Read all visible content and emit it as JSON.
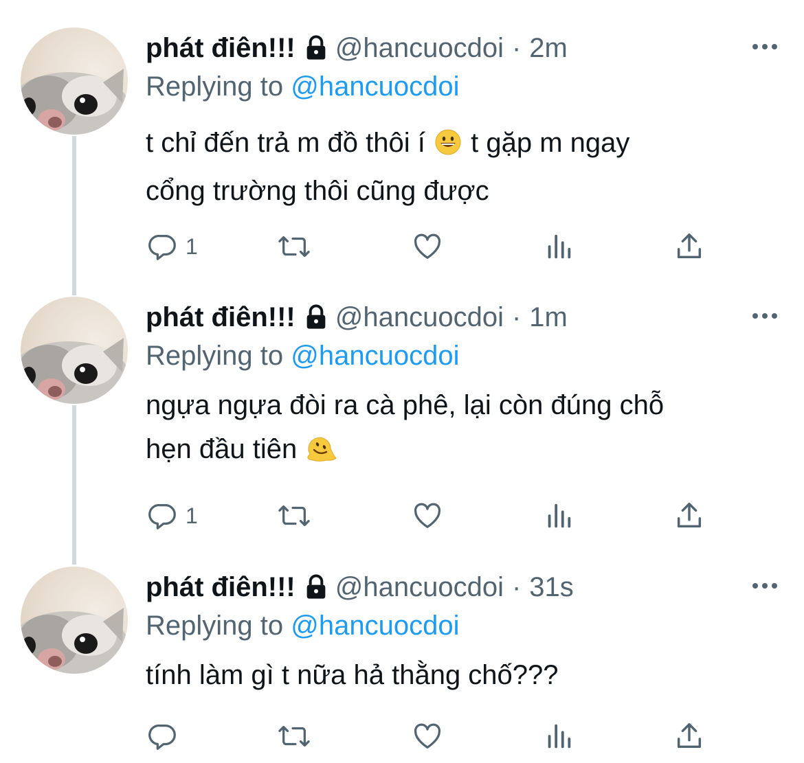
{
  "tweets": [
    {
      "name": "phát điên!!!",
      "handle": "@hancuocdoi",
      "time": "2m",
      "replying_prefix": "Replying to",
      "replying_handle": "@hancuocdoi",
      "text_line1_a": "t chỉ đến trả m đồ thôi í",
      "text_line1_b": "t gặp m ngay",
      "text_line2": "cổng trường thôi cũng được",
      "emoji": "grinning-face",
      "reply_count": "1"
    },
    {
      "name": "phát điên!!!",
      "handle": "@hancuocdoi",
      "time": "1m",
      "replying_prefix": "Replying to",
      "replying_handle": "@hancuocdoi",
      "text_line1": "ngựa ngựa đòi ra cà phê, lại còn đúng chỗ",
      "text_line2": "hẹn đầu tiên",
      "emoji": "melting-face",
      "reply_count": "1"
    },
    {
      "name": "phát điên!!!",
      "handle": "@hancuocdoi",
      "time": "31s",
      "replying_prefix": "Replying to",
      "replying_handle": "@hancuocdoi",
      "text_line1": "tính làm gì t nữa hả thằng chố???",
      "reply_count": ""
    }
  ],
  "colors": {
    "text": "#0f1419",
    "secondary": "#536471",
    "link": "#1d9bf0",
    "thread_line": "#cfd9de"
  }
}
